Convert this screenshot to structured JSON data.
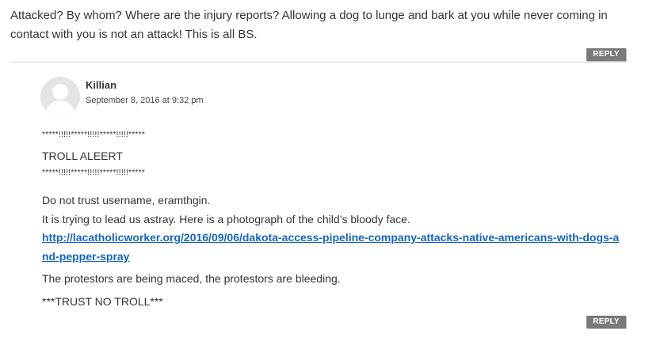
{
  "parent_comment": {
    "text": "Attacked? By whom? Where are the injury reports? Allowing a dog to lunge and bark at you while never coming in contact with you is not an attack! This is all BS.",
    "reply_label": "REPLY"
  },
  "reply_comment": {
    "author": "Killian",
    "date": "September 8, 2016 at 9:32 pm",
    "line1": "*****!!!!!*****!!!!!*****!!!!!*****",
    "line2": "TROLL ALEERT",
    "line3": "*****!!!!!*****!!!!!*****!!!!!*****",
    "line4a": "Do not trust username, eramthgin.",
    "line4b": "It is trying to lead us astray. Here is a photograph of the child’s bloody face.",
    "link": "http://lacatholicworker.org/2016/09/06/dakota-access-pipeline-company-attacks-native-americans-with-dogs-and-pepper-spray",
    "line5": "The protestors are being maced, the protestors are bleeding.",
    "line6": "***TRUST NO TROLL***",
    "reply_label": "REPLY"
  },
  "icons": {
    "avatar": "default-user-avatar"
  }
}
